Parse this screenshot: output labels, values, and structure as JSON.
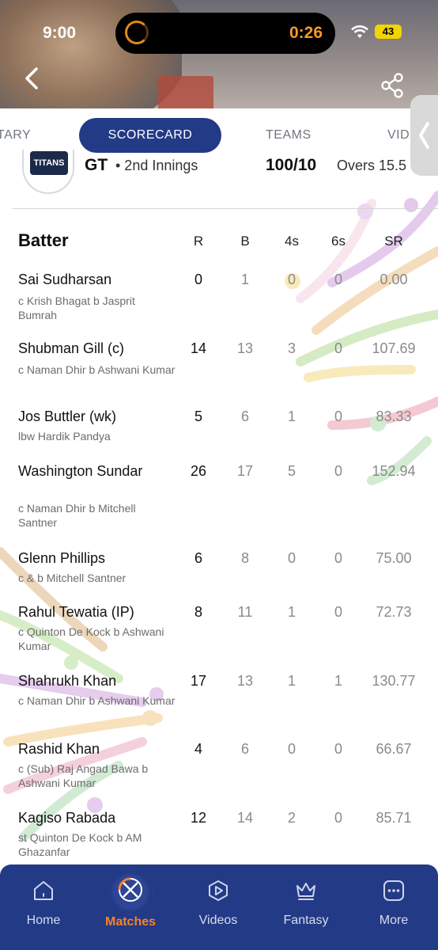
{
  "status_bar": {
    "time": "9:00",
    "timer": "0:26",
    "battery": "43"
  },
  "header": {
    "back_icon": "chevron-left-icon",
    "share_icon": "share-icon"
  },
  "tabs": [
    {
      "label": "TARY",
      "active": false
    },
    {
      "label": "SCORECARD",
      "active": true
    },
    {
      "label": "TEAMS",
      "active": false
    },
    {
      "label": "VID",
      "active": false
    }
  ],
  "innings": {
    "team_logo_text": "TITANS",
    "team_code": "GT",
    "innings_label": "• 2nd Innings",
    "score": "100/10",
    "overs": "Overs 15.5"
  },
  "table": {
    "headers": {
      "batter": "Batter",
      "r": "R",
      "b": "B",
      "fours": "4s",
      "sixes": "6s",
      "sr": "SR"
    },
    "rows": [
      {
        "name": "Sai Sudharsan",
        "dismissal": "c Krish Bhagat b Jasprit Bumrah",
        "r": "0",
        "b": "1",
        "fours": "0",
        "sixes": "0",
        "sr": "0.00"
      },
      {
        "name": "Shubman Gill (c)",
        "dismissal": "c Naman Dhir b Ashwani Kumar",
        "r": "14",
        "b": "13",
        "fours": "3",
        "sixes": "0",
        "sr": "107.69"
      },
      {
        "name": "Jos Buttler (wk)",
        "dismissal": "lbw Hardik Pandya",
        "r": "5",
        "b": "6",
        "fours": "1",
        "sixes": "0",
        "sr": "83.33"
      },
      {
        "name": "Washington Sundar",
        "dismissal": "c Naman Dhir b Mitchell Santner",
        "r": "26",
        "b": "17",
        "fours": "5",
        "sixes": "0",
        "sr": "152.94"
      },
      {
        "name": "Glenn Phillips",
        "dismissal": "c & b Mitchell Santner",
        "r": "6",
        "b": "8",
        "fours": "0",
        "sixes": "0",
        "sr": "75.00"
      },
      {
        "name": "Rahul Tewatia  (IP)",
        "dismissal": "c Quinton De Kock b Ashwani Kumar",
        "r": "8",
        "b": "11",
        "fours": "1",
        "sixes": "0",
        "sr": "72.73"
      },
      {
        "name": "Shahrukh Khan",
        "dismissal": "c Naman Dhir b Ashwani Kumar",
        "r": "17",
        "b": "13",
        "fours": "1",
        "sixes": "1",
        "sr": "130.77"
      },
      {
        "name": "Rashid Khan",
        "dismissal": "c (Sub) Raj Angad Bawa b Ashwani Kumar",
        "r": "4",
        "b": "6",
        "fours": "0",
        "sixes": "0",
        "sr": "66.67"
      },
      {
        "name": "Kagiso Rabada",
        "dismissal": "st Quinton De Kock b AM Ghazanfar",
        "r": "12",
        "b": "14",
        "fours": "2",
        "sixes": "0",
        "sr": "85.71"
      }
    ]
  },
  "bottom_nav": [
    {
      "label": "Home",
      "icon": "home-icon",
      "active": false
    },
    {
      "label": "Matches",
      "icon": "matches-icon",
      "active": true
    },
    {
      "label": "Videos",
      "icon": "videos-icon",
      "active": false
    },
    {
      "label": "Fantasy",
      "icon": "crown-icon",
      "active": false
    },
    {
      "label": "More",
      "icon": "more-icon",
      "active": false
    }
  ],
  "colors": {
    "primary": "#233a86",
    "accent": "#f2842a"
  }
}
